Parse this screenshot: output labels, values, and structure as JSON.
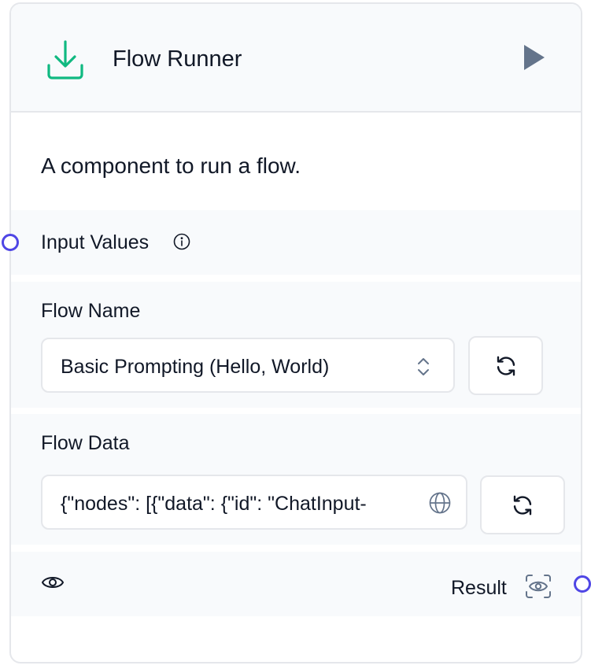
{
  "node": {
    "title": "Flow Runner",
    "description": "A component to run a flow.",
    "icon": "download-icon",
    "run_icon": "play-icon"
  },
  "inputs": {
    "input_values": {
      "label": "Input Values",
      "icon": "info-icon"
    },
    "flow_name": {
      "label": "Flow Name",
      "value": "Basic Prompting (Hello, World)",
      "icon": "chevron-up-down-icon",
      "refresh_icon": "refresh-icon"
    },
    "flow_data": {
      "label": "Flow Data",
      "value": "{\"nodes\": [{\"data\": {\"id\": \"ChatInput-",
      "icon": "globe-icon",
      "refresh_icon": "refresh-icon"
    }
  },
  "output": {
    "label": "Result",
    "visibility_icon": "eye-icon",
    "inspect_icon": "scan-eye-icon"
  },
  "colors": {
    "accent": "#10b981",
    "handle": "#4f46e5",
    "icon_muted": "#64748b",
    "section_bg": "#f8fafc",
    "border": "#e5e7eb"
  }
}
